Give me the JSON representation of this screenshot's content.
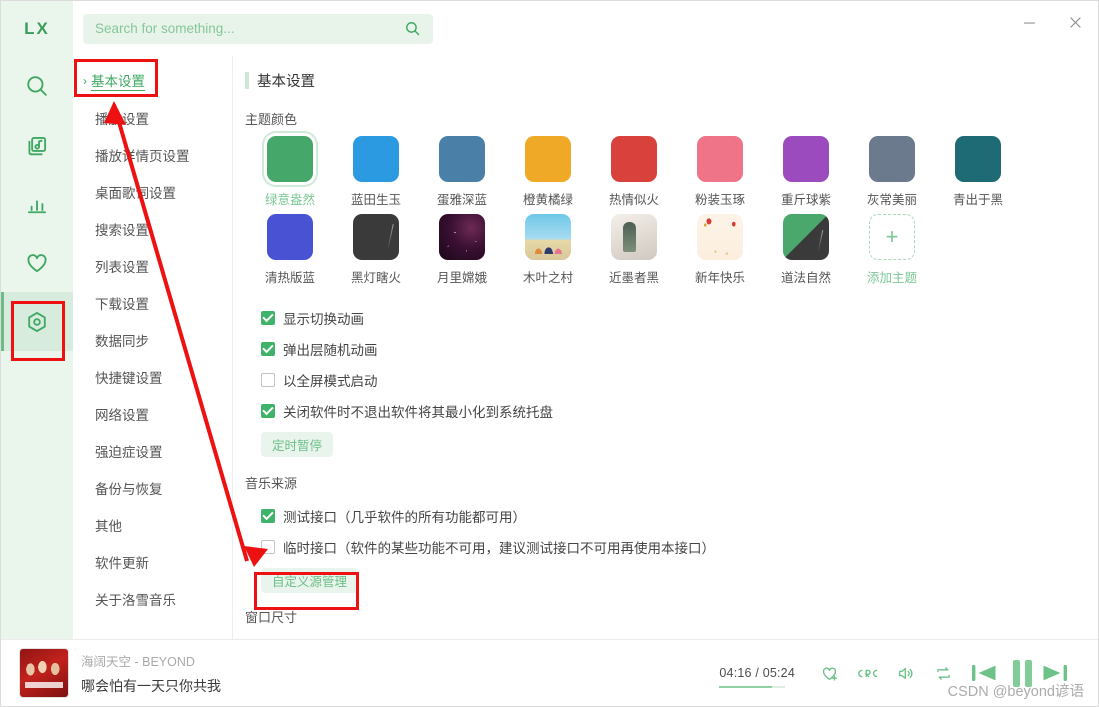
{
  "app": {
    "logo": "LX"
  },
  "titlebar": {
    "search_placeholder": "Search for something...",
    "search_value": "",
    "minimize_label": "—",
    "close_label": "✕"
  },
  "rail": {
    "items": [
      {
        "name": "search-icon",
        "label": "搜索"
      },
      {
        "name": "music-library-icon",
        "label": "歌单"
      },
      {
        "name": "chart-icon",
        "label": "排行榜"
      },
      {
        "name": "heart-icon",
        "label": "我的收藏"
      },
      {
        "name": "settings-icon",
        "label": "设置",
        "active": true
      }
    ]
  },
  "settings_nav": {
    "items": [
      {
        "label": "基本设置",
        "active": true
      },
      {
        "label": "播放设置",
        "active": false
      },
      {
        "label": "播放详情页设置",
        "active": false
      },
      {
        "label": "桌面歌词设置",
        "active": false
      },
      {
        "label": "搜索设置",
        "active": false
      },
      {
        "label": "列表设置",
        "active": false
      },
      {
        "label": "下载设置",
        "active": false
      },
      {
        "label": "数据同步",
        "active": false
      },
      {
        "label": "快捷键设置",
        "active": false
      },
      {
        "label": "网络设置",
        "active": false
      },
      {
        "label": "强迫症设置",
        "active": false
      },
      {
        "label": "备份与恢复",
        "active": false
      },
      {
        "label": "其他",
        "active": false
      },
      {
        "label": "软件更新",
        "active": false
      },
      {
        "label": "关于洛雪音乐",
        "active": false
      }
    ],
    "chevron": "›"
  },
  "panel": {
    "title": "基本设置",
    "theme_section_label": "主题颜色",
    "themes": [
      {
        "label": "绿意盎然",
        "color": "#45a86a",
        "kind": "color",
        "selected": true
      },
      {
        "label": "蓝田生玉",
        "color": "#2b9ae0",
        "kind": "color",
        "selected": false
      },
      {
        "label": "蛋雅深蓝",
        "color": "#4a80a8",
        "kind": "color",
        "selected": false
      },
      {
        "label": "橙黄橘绿",
        "color": "#efa927",
        "kind": "color",
        "selected": false
      },
      {
        "label": "热情似火",
        "color": "#d9413d",
        "kind": "color",
        "selected": false
      },
      {
        "label": "粉装玉琢",
        "color": "#ef7487",
        "kind": "color",
        "selected": false
      },
      {
        "label": "重斤球紫",
        "color": "#9b4bbd",
        "kind": "color",
        "selected": false
      },
      {
        "label": "灰常美丽",
        "color": "#6b7a8c",
        "kind": "color",
        "selected": false
      },
      {
        "label": "青出于黑",
        "color": "#1e6b75",
        "kind": "color",
        "selected": false
      },
      {
        "label": "",
        "color": "",
        "kind": "spacer",
        "selected": false
      },
      {
        "label": "清热版蓝",
        "color": "#4a52d4",
        "kind": "color",
        "selected": false
      },
      {
        "label": "黑灯瞎火",
        "color": "#3a3a3a",
        "kind": "image-dark",
        "selected": false
      },
      {
        "label": "月里嫦娥",
        "color": "#2a0f28",
        "kind": "image-moon",
        "selected": false
      },
      {
        "label": "木叶之村",
        "color": "#7bc9e8",
        "kind": "image-village",
        "selected": false
      },
      {
        "label": "近墨者黑",
        "color": "#e5e0d8",
        "kind": "image-ink",
        "selected": false
      },
      {
        "label": "新年快乐",
        "color": "#fbeedd",
        "kind": "image-newyear",
        "selected": false
      },
      {
        "label": "道法自然",
        "color": "#4aa86c",
        "kind": "image-tao",
        "selected": false
      },
      {
        "label": "添加主题",
        "color": "",
        "kind": "add",
        "selected": false
      }
    ],
    "options": [
      {
        "label": "显示切换动画",
        "checked": true
      },
      {
        "label": "弹出层随机动画",
        "checked": true
      },
      {
        "label": "以全屏模式启动",
        "checked": false
      },
      {
        "label": "关闭软件时不退出软件将其最小化到系统托盘",
        "checked": true
      }
    ],
    "timer_pause_button": "定时暂停",
    "source_section_label": "音乐来源",
    "sources": [
      {
        "label": "测试接口（几乎软件的所有功能都可用）",
        "checked": true
      },
      {
        "label": "临时接口（软件的某些功能不可用，建议测试接口不可用再使用本接口）",
        "checked": false
      }
    ],
    "custom_source_button": "自定义源管理",
    "window_size_label": "窗口尺寸"
  },
  "player": {
    "track_title": "海阔天空 - BEYOND",
    "lyric_line": "哪会怕有一天只你共我",
    "current_time": "04:16",
    "total_time": "05:24",
    "time_display": "04:16 / 05:24",
    "progress_percent": 80,
    "controls": [
      {
        "name": "favorite-icon",
        "label": "收藏"
      },
      {
        "name": "lyrics-icon",
        "label": "LRC"
      },
      {
        "name": "volume-icon",
        "label": "音量"
      },
      {
        "name": "repeat-icon",
        "label": "播放模式"
      },
      {
        "name": "previous-icon",
        "label": "上一曲"
      },
      {
        "name": "pause-icon",
        "label": "暂停"
      },
      {
        "name": "next-icon",
        "label": "下一曲"
      }
    ]
  },
  "watermark": "CSDN @beyond谚语",
  "colors": {
    "accent": "#3fa863",
    "accent_light": "#e8f4ea",
    "rail_bg": "#eaf5ec",
    "highlight": "#ee1111"
  }
}
